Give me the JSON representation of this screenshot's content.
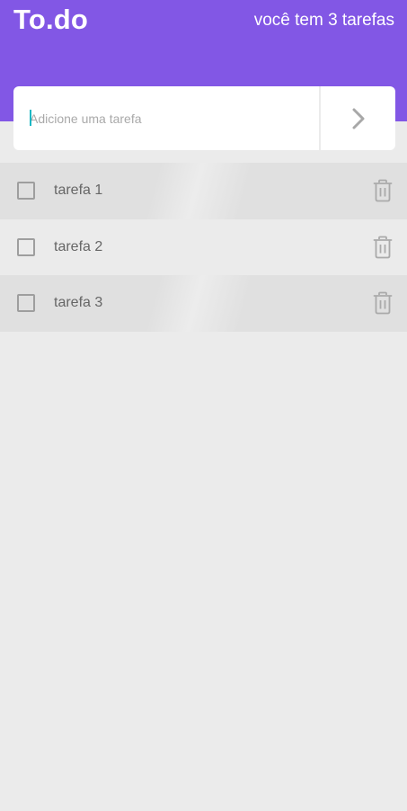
{
  "header": {
    "logo": "To.do",
    "counter": "você tem 3 tarefas",
    "accent_color": "#8257e5"
  },
  "new_task": {
    "placeholder": "Adicione uma tarefa",
    "value": "",
    "submit_icon": "chevron-right-icon"
  },
  "tasks": [
    {
      "label": "tarefa 1",
      "done": false,
      "delete_icon": "trash-icon"
    },
    {
      "label": "tarefa 2",
      "done": false,
      "delete_icon": "trash-icon"
    },
    {
      "label": "tarefa 3",
      "done": false,
      "delete_icon": "trash-icon"
    }
  ]
}
